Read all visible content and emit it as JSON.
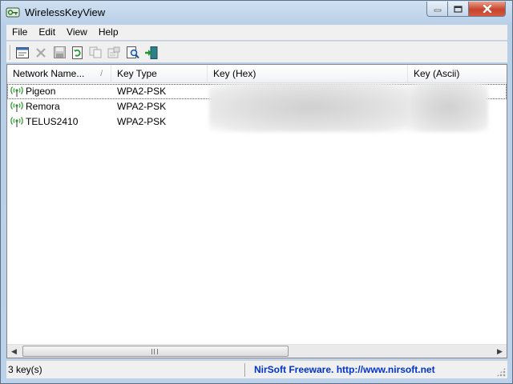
{
  "window": {
    "title": "WirelessKeyView"
  },
  "menu": [
    {
      "label": "File"
    },
    {
      "label": "Edit"
    },
    {
      "label": "View"
    },
    {
      "label": "Help"
    }
  ],
  "toolbar": {
    "buttons": [
      {
        "icon": "html-report-icon"
      },
      {
        "icon": "delete-icon"
      },
      {
        "icon": "save-icon"
      },
      {
        "icon": "refresh-icon"
      },
      {
        "icon": "copy-icon"
      },
      {
        "icon": "properties-icon"
      },
      {
        "icon": "find-icon"
      },
      {
        "icon": "exit-icon"
      }
    ]
  },
  "list": {
    "columns": [
      {
        "label": "Network Name...",
        "sort": "/"
      },
      {
        "label": "Key Type"
      },
      {
        "label": "Key (Hex)"
      },
      {
        "label": "Key (Ascii)"
      }
    ],
    "rows": [
      {
        "network": "Pigeon",
        "key_type": "WPA2-PSK",
        "icon": "wifi-signal-icon"
      },
      {
        "network": "Remora",
        "key_type": "WPA2-PSK",
        "icon": "wifi-signal-icon"
      },
      {
        "network": "TELUS2410",
        "key_type": "WPA2-PSK",
        "icon": "wifi-signal-icon"
      }
    ]
  },
  "status": {
    "count": "3 key(s)",
    "link": "NirSoft Freeware.  http://www.nirsoft.net"
  },
  "colors": {
    "link": "#0033cc",
    "wifi_icon": "#2a9a2a",
    "close_button": "#c7442c"
  }
}
